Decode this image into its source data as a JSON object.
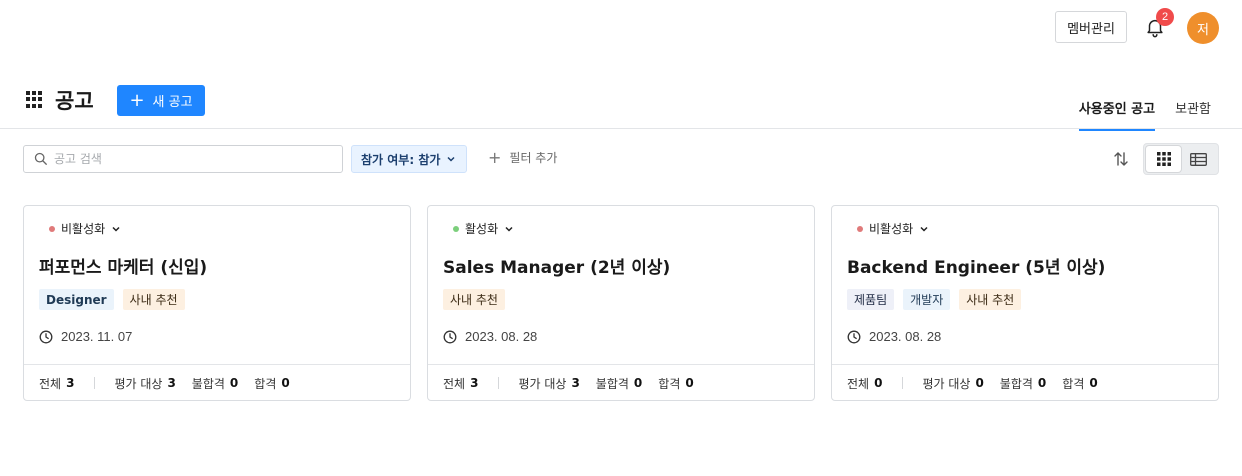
{
  "header": {
    "member_button": "멤버관리",
    "notification_count": "2",
    "avatar_initial": "저"
  },
  "page": {
    "title": "공고",
    "new_button": "새 공고",
    "tabs": [
      {
        "label": "사용중인 공고",
        "active": true
      },
      {
        "label": "보관함",
        "active": false
      }
    ]
  },
  "filters": {
    "search_placeholder": "공고 검색",
    "participation_filter": "참가 여부: 참가",
    "add_filter": "필터 추가"
  },
  "labels": {
    "total": "전체",
    "under_review": "평가 대상",
    "failed": "불합격",
    "passed": "합격"
  },
  "colors": {
    "accent": "#1f86ff",
    "inactive_dot": "#e07a7a",
    "active_dot": "#7ccf7c",
    "badge_red": "#f04b4b",
    "avatar_orange": "#ef8f2c"
  },
  "cards": [
    {
      "status": "비활성화",
      "status_color": "#e07a7a",
      "title": "퍼포먼스 마케터 (신입)",
      "tags": [
        {
          "label": "Designer",
          "bg": "#eaf3fb",
          "color": "#1f3a55"
        },
        {
          "label": "사내 추천",
          "bg": "#fdf0e1",
          "color": "#3b2a14"
        }
      ],
      "date": "2023. 11. 07",
      "total": "3",
      "under_review": "3",
      "failed": "0",
      "passed": "0"
    },
    {
      "status": "활성화",
      "status_color": "#7ccf7c",
      "title": "Sales Manager (2년 이상)",
      "tags": [
        {
          "label": "사내 추천",
          "bg": "#fdf0e1",
          "color": "#3b2a14"
        }
      ],
      "date": "2023. 08. 28",
      "total": "3",
      "under_review": "3",
      "failed": "0",
      "passed": "0"
    },
    {
      "status": "비활성화",
      "status_color": "#e07a7a",
      "title": "Backend Engineer (5년 이상)",
      "tags": [
        {
          "label": "제품팀",
          "bg": "#eef0f8",
          "color": "#1f2a44"
        },
        {
          "label": "개발자",
          "bg": "#eaf3fb",
          "color": "#1f3a55"
        },
        {
          "label": "사내 추천",
          "bg": "#fdf0e1",
          "color": "#3b2a14"
        }
      ],
      "date": "2023. 08. 28",
      "total": "0",
      "under_review": "0",
      "failed": "0",
      "passed": "0"
    }
  ]
}
